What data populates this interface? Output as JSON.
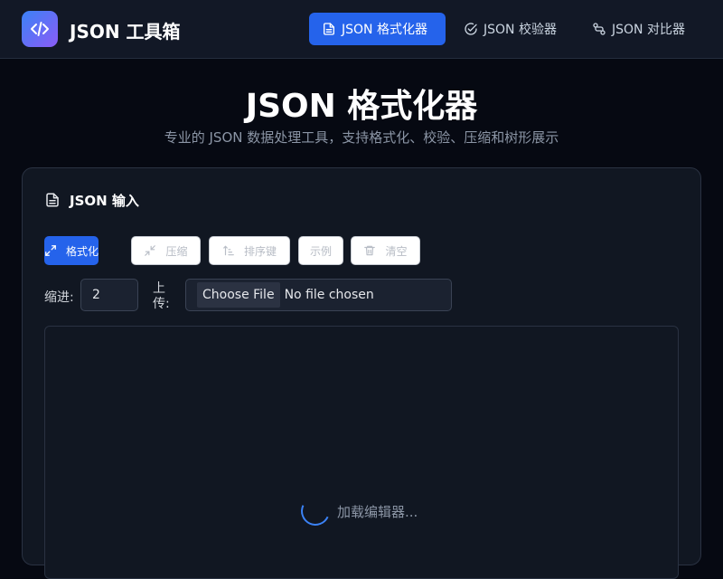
{
  "header": {
    "logo_icon": "code-icon",
    "app_title": "JSON 工具箱",
    "nav": [
      {
        "label": "JSON 格式化器",
        "icon": "document-icon",
        "active": true
      },
      {
        "label": "JSON 校验器",
        "icon": "check-circle-icon",
        "active": false
      },
      {
        "label": "JSON 对比器",
        "icon": "compare-icon",
        "active": false
      }
    ]
  },
  "page": {
    "title": "JSON 格式化器",
    "subtitle": "专业的 JSON 数据处理工具，支持格式化、校验、压缩和树形展示"
  },
  "card": {
    "title": "JSON 输入",
    "toolbar": {
      "format": "格式化",
      "compress": "压缩",
      "sort_keys": "排序键",
      "example": "示例",
      "clear": "清空"
    },
    "indent_label": "缩进:",
    "indent_value": "2",
    "upload_label": "上传:",
    "file_button": "Choose File",
    "file_status": "No file chosen",
    "loading_text": "加载编辑器..."
  },
  "colors": {
    "accent": "#2563eb",
    "background": "#060912",
    "header_bg": "#121826",
    "card_bg": "#111722"
  }
}
